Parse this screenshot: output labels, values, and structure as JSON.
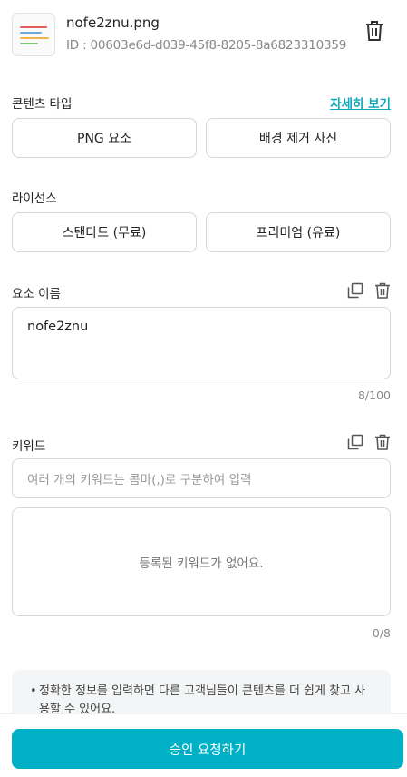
{
  "file": {
    "name": "nofe2znu.png",
    "id": "ID : 00603e6d-d039-45f8-8205-8a6823310359"
  },
  "content_type": {
    "label": "콘텐츠 타입",
    "detail_link": "자세히 보기",
    "options": [
      "PNG 요소",
      "배경 제거 사진"
    ]
  },
  "license": {
    "label": "라이선스",
    "options": [
      "스탠다드 (무료)",
      "프리미엄 (유료)"
    ]
  },
  "element_name": {
    "label": "요소 이름",
    "value": "nofe2znu",
    "counter": "8/100"
  },
  "keywords": {
    "label": "키워드",
    "placeholder": "여러 개의 키워드는 콤마(,)로 구분하여 입력",
    "empty_text": "등록된 키워드가 없어요.",
    "counter": "0/8"
  },
  "notice": {
    "bullet": "•",
    "text": "정확한 정보를 입력하면 다른 고객님들이 콘텐츠를 더 쉽게 찾고 사용할 수 있어요."
  },
  "submit_label": "승인 요청하기",
  "colors": {
    "accent": "#00b0c4",
    "link": "#11a7bd"
  }
}
